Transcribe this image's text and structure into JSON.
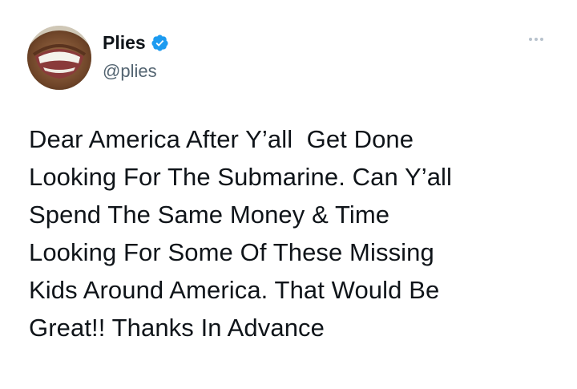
{
  "author": {
    "display_name": "Plies",
    "handle": "@plies",
    "verified": true,
    "verified_color": "#1d9bf0"
  },
  "icons": {
    "avatar": "profile-photo-smiling-face",
    "verified": "verified-badge-icon",
    "more": "more-options-ellipsis-icon"
  },
  "tweet": {
    "lines": [
      "Dear America After Y’all  Get Done",
      "Looking For The Submarine. Can Y’all",
      "Spend The Same Money & Time",
      "Looking For Some Of These Missing",
      "Kids Around America. That Would Be",
      "Great!! Thanks In Advance"
    ]
  }
}
